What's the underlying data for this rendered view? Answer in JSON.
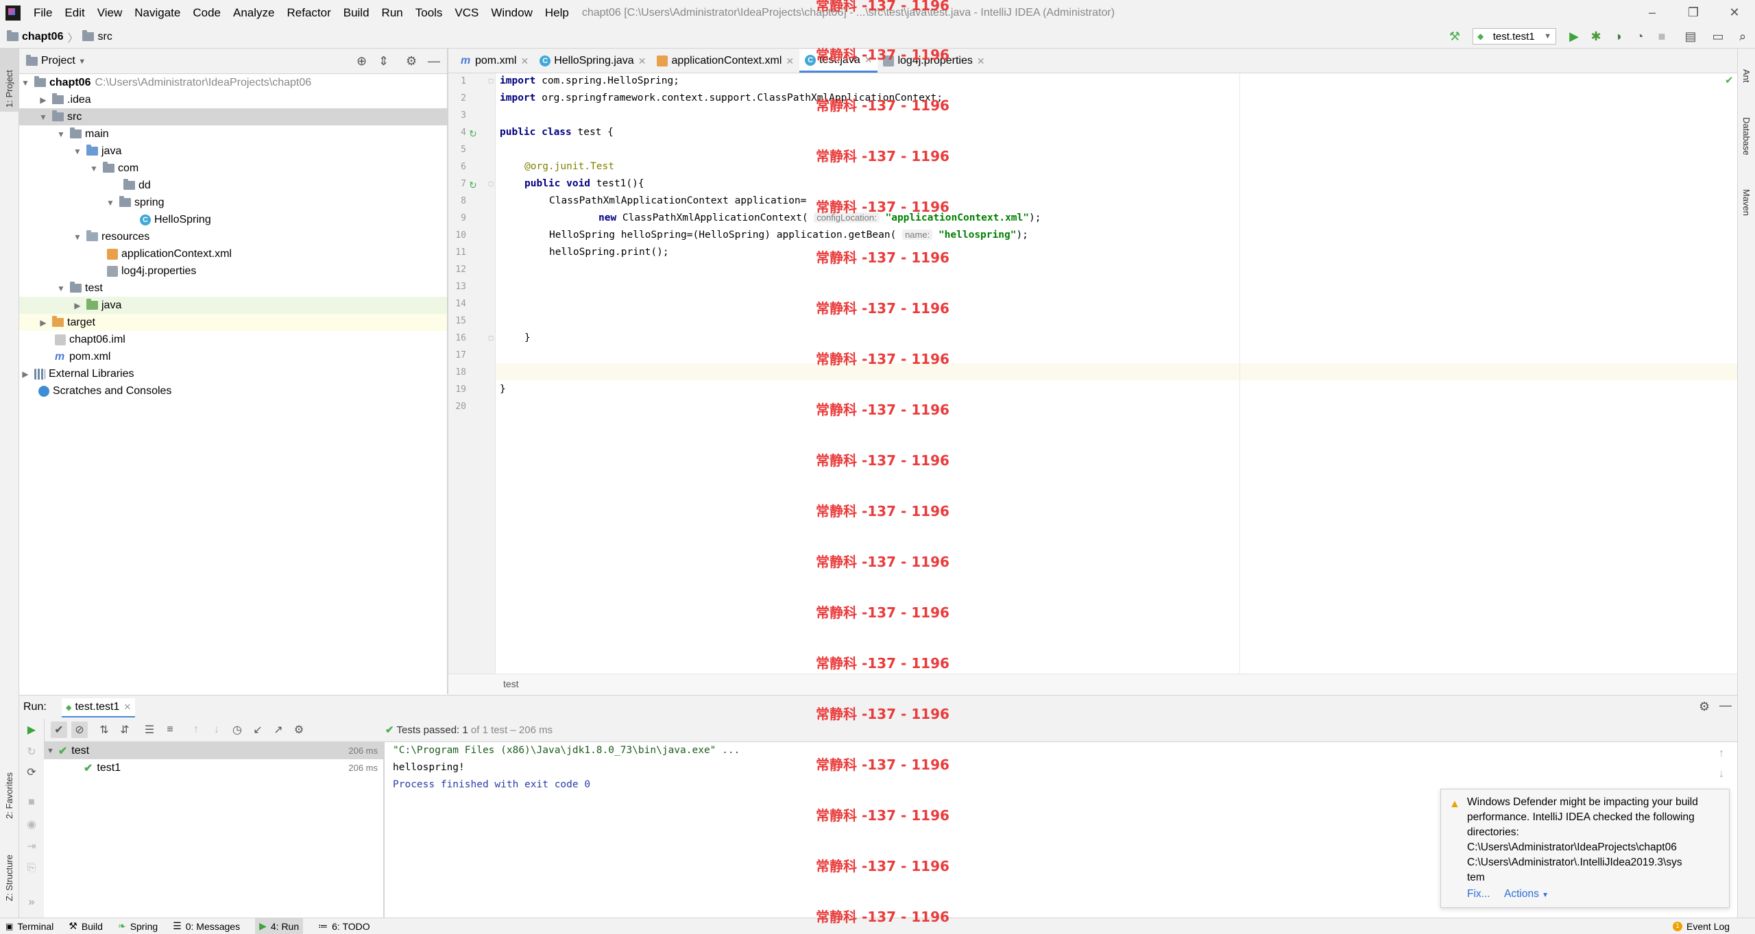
{
  "window": {
    "title": "chapt06 [C:\\Users\\Administrator\\IdeaProjects\\chapt06] - ...\\src\\test\\java\\test.java - IntelliJ IDEA (Administrator)",
    "controls": [
      "–",
      "❐",
      "✕"
    ]
  },
  "menu": [
    "File",
    "Edit",
    "View",
    "Navigate",
    "Code",
    "Analyze",
    "Refactor",
    "Build",
    "Run",
    "Tools",
    "VCS",
    "Window",
    "Help"
  ],
  "breadcrumb": [
    "chapt06",
    "src"
  ],
  "run_config": "test.test1",
  "left_stripe": {
    "project": "1: Project",
    "favorites": "2: Favorites",
    "structure": "Z: Structure"
  },
  "right_stripe": {
    "ant": "Ant",
    "database": "Database",
    "maven": "Maven"
  },
  "project_panel": {
    "title": "Project",
    "tree": [
      {
        "label": "chapt06",
        "path": "C:\\Users\\Administrator\\IdeaProjects\\chapt06"
      },
      {
        "label": ".idea"
      },
      {
        "label": "src"
      },
      {
        "label": "main"
      },
      {
        "label": "java"
      },
      {
        "label": "com"
      },
      {
        "label": "dd"
      },
      {
        "label": "spring"
      },
      {
        "label": "HelloSpring"
      },
      {
        "label": "resources"
      },
      {
        "label": "applicationContext.xml"
      },
      {
        "label": "log4j.properties"
      },
      {
        "label": "test"
      },
      {
        "label": "java"
      },
      {
        "label": "target"
      },
      {
        "label": "chapt06.iml"
      },
      {
        "label": "pom.xml"
      },
      {
        "label": "External Libraries"
      },
      {
        "label": "Scratches and Consoles"
      }
    ]
  },
  "editor_tabs": [
    {
      "label": "pom.xml"
    },
    {
      "label": "HelloSpring.java"
    },
    {
      "label": "applicationContext.xml"
    },
    {
      "label": "test.java",
      "active": true
    },
    {
      "label": "log4j.properties"
    }
  ],
  "code": {
    "line_numbers": [
      "1",
      "2",
      "3",
      "4",
      "5",
      "6",
      "7",
      "8",
      "9",
      "10",
      "11",
      "12",
      "13",
      "14",
      "15",
      "16",
      "17",
      "18",
      "19",
      "20"
    ],
    "l1_kw": "import",
    "l1_rest": " com.spring.HelloSpring;",
    "l2_kw": "import",
    "l2_rest": " org.springframework.context.support.ClassPathXmlApplicationContext;",
    "l4_kw": "public class",
    "l4_rest": " test {",
    "l6_ann": "@org.junit.",
    "l6_ann2": "Test",
    "l7_kw": "public void",
    "l7_rest": " test1(){",
    "l8": "ClassPathXmlApplicationContext application=",
    "l9_kw": "new",
    "l9_rest": " ClassPathXmlApplicationContext(",
    "l9_hint": "configLocation:",
    "l9_str": "\"applicationContext.xml\"",
    "l9_end": ");",
    "l10": "HelloSpring helloSpring=(HelloSpring) application.getBean(",
    "l10_hint": "name:",
    "l10_str": "\"hellospring\"",
    "l10_end": ");",
    "l11": "helloSpring.print();",
    "l16": "}",
    "l19": "}"
  },
  "editor_breadcrumb": "test",
  "run_panel": {
    "label": "Run:",
    "tab": "test.test1",
    "status_prefix": "Tests passed:",
    "passed": "1",
    "status_suffix": "of 1 test – 206 ms",
    "tests": [
      {
        "name": "test",
        "time": "206 ms"
      },
      {
        "name": "test1",
        "time": "206 ms"
      }
    ],
    "console": [
      "\"C:\\Program Files (x86)\\Java\\jdk1.8.0_73\\bin\\java.exe\" ...",
      "hellospring!",
      "Process finished with exit code 0"
    ]
  },
  "notification": {
    "text": "Windows Defender might be impacting your build performance. IntelliJ IDEA checked the following directories:",
    "dir1": "C:\\Users\\Administrator\\IdeaProjects\\chapt06",
    "dir2": "C:\\Users\\Administrator\\.IntelliJIdea2019.3\\sys",
    "dir2b": "tem",
    "fix": "Fix...",
    "actions": "Actions"
  },
  "statusbar": {
    "terminal": "Terminal",
    "build": "Build",
    "spring": "Spring",
    "messages": "0: Messages",
    "run": "4: Run",
    "todo": "6: TODO",
    "event_log": "Event Log"
  },
  "watermark": "常静科 -137 - 1196",
  "colors": {
    "accent": "#4a88d8",
    "pass_green": "#4caf50",
    "watermark_red": "#ea3b3b"
  }
}
